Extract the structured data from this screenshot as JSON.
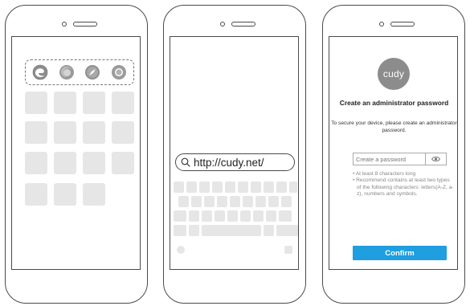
{
  "phone_browser": {
    "url": "http://cudy.net/",
    "icons": [
      "search-icon"
    ]
  },
  "phone_home": {
    "icons": [
      "edge-browser-icon",
      "firefox-browser-icon",
      "safari-browser-icon",
      "chrome-browser-icon"
    ]
  },
  "phone_setup": {
    "logo_text": "cudy",
    "title": "Create an administrator password",
    "subtitle": "To secure your device, please create an administrator password.",
    "password_placeholder": "Create a password",
    "rules": [
      "• At least 8 characters long",
      "• Recommend contains at least two types of the following characters: letters(A-Z, a-z), numbers and symbols."
    ],
    "confirm_label": "Confirm",
    "colors": {
      "accent": "#1f9ee0",
      "logo": "#8c8c8c"
    },
    "icons": [
      "eye-icon"
    ]
  }
}
